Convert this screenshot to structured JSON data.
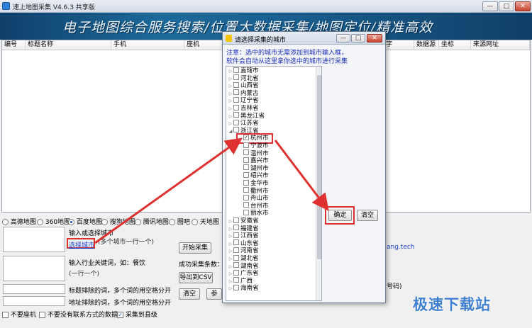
{
  "window": {
    "title": "速上地图采集 V4.6.3 共享版",
    "minimize": "—",
    "maximize": "□",
    "close": "✕"
  },
  "banner": {
    "slogan": "电子地图综合服务搜索/位置大数据采集/地图定位/精准高效"
  },
  "table": {
    "columns": [
      "编号",
      "标题名称",
      "手机",
      "座机",
      "字",
      "数据源",
      "坐标",
      "来源网址"
    ]
  },
  "maps": {
    "options": [
      "高德地图",
      "360地图",
      "百度地图",
      "搜狗地图",
      "腾讯地图",
      "图吧",
      "天地图"
    ],
    "selected": "百度地图"
  },
  "city": {
    "label": "输入或选择城市",
    "choose_link": "选择城市",
    "hint": "(多个城市一行一个)"
  },
  "keyword": {
    "label": "输入行业关键词，如：餐饮",
    "hint": "(一行一个)"
  },
  "exclude": {
    "title_label": "标题排除的词，多个词的用空格分开",
    "address_label": "地址排除的词，多个词的用空格分开"
  },
  "buttons": {
    "start": "开始采集",
    "export": "导出到CSV",
    "clear": "清空",
    "params": "参"
  },
  "status": {
    "count_label": "成功采集条数："
  },
  "checkboxes": [
    {
      "label": "不要座机",
      "checked": false
    },
    {
      "label": "不要没有联系方式的数据",
      "checked": false
    },
    {
      "label": "采集到县级",
      "checked": true
    }
  ],
  "right_partial": {
    "url_fragment": "ang.tech",
    "hint_fragment": "号码)"
  },
  "dialog": {
    "title": "请选择采集的城市",
    "notice_line1": "注意：选中的城市无需添加到城市输入框，",
    "notice_line2": "软件会自动从这里拿你选中的城市进行采集",
    "confirm": "确定",
    "clear": "清空",
    "provinces_top": [
      "直辖市",
      "河北省",
      "山西省",
      "内蒙古",
      "辽宁省",
      "吉林省",
      "黑龙江省",
      "江苏省",
      "浙江省"
    ],
    "zhejiang_cities": [
      {
        "name": "杭州市",
        "checked": true
      },
      {
        "name": "宁波市",
        "checked": false
      },
      {
        "name": "温州市",
        "checked": false
      },
      {
        "name": "嘉兴市",
        "checked": false
      },
      {
        "name": "湖州市",
        "checked": false
      },
      {
        "name": "绍兴市",
        "checked": false
      },
      {
        "name": "金华市",
        "checked": false
      },
      {
        "name": "衢州市",
        "checked": false
      },
      {
        "name": "舟山市",
        "checked": false
      },
      {
        "name": "台州市",
        "checked": false
      },
      {
        "name": "丽水市",
        "checked": false
      }
    ],
    "provinces_bottom": [
      "安徽省",
      "福建省",
      "江西省",
      "山东省",
      "河南省",
      "湖北省",
      "湖南省",
      "广东省",
      "广西",
      "海南省"
    ]
  },
  "watermark": "极速下载站",
  "colors": {
    "banner": "#1c6a9a",
    "highlight": "#e03131",
    "link": "#1a3fcf"
  }
}
